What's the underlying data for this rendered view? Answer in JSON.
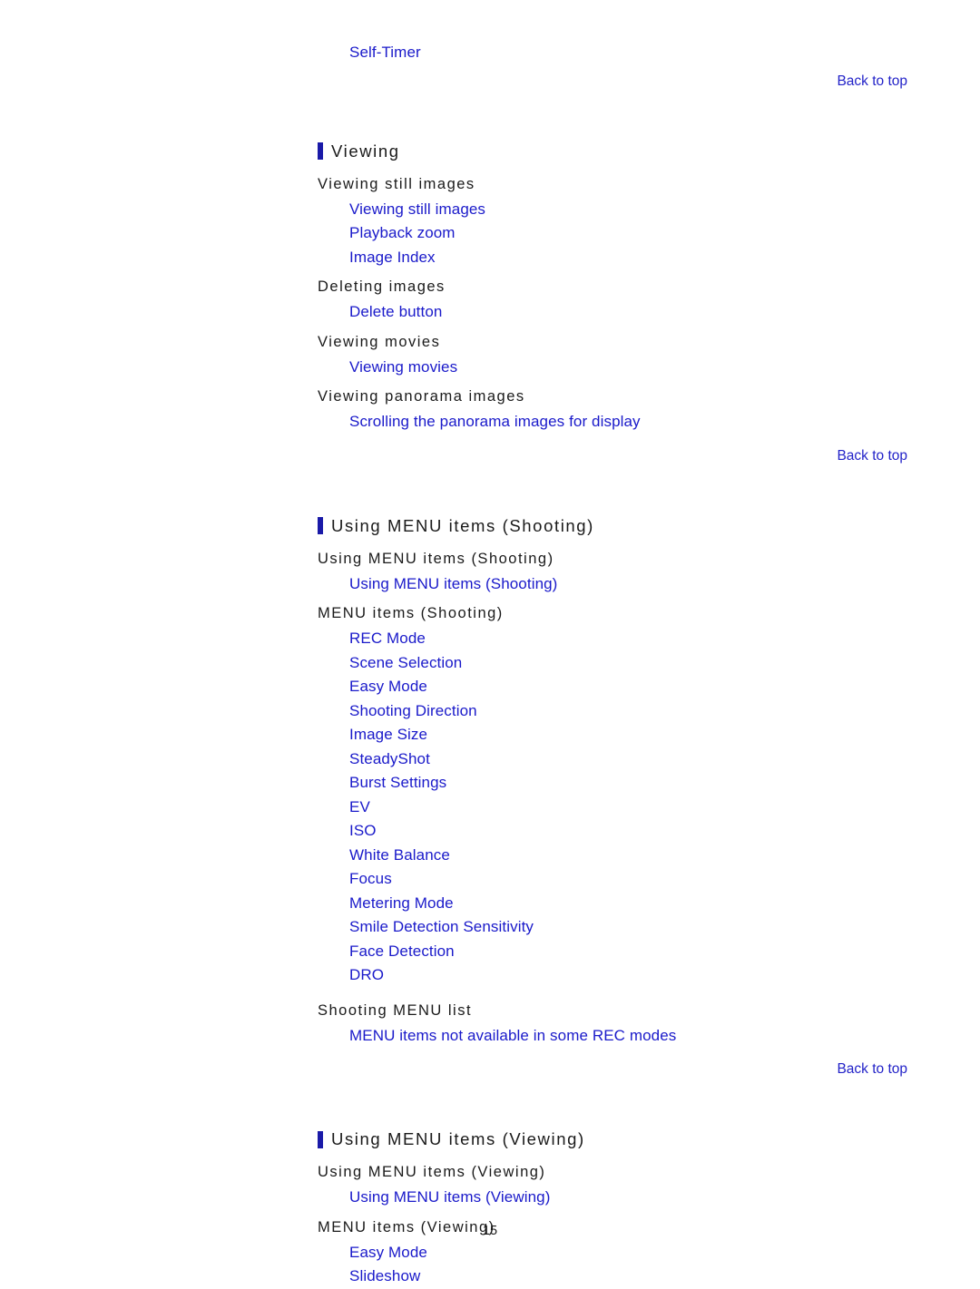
{
  "page": {
    "number": "15",
    "back_to_top_label": "Back to top"
  },
  "top_orphan_link": "Self-Timer",
  "sections": [
    {
      "title": "Viewing",
      "groups": [
        {
          "heading": "Viewing still images",
          "links": [
            "Viewing still images",
            "Playback zoom",
            "Image Index"
          ]
        },
        {
          "heading": "Deleting images",
          "links": [
            "Delete button"
          ]
        },
        {
          "heading": "Viewing movies",
          "links": [
            "Viewing movies"
          ]
        },
        {
          "heading": "Viewing panorama images",
          "links": [
            "Scrolling the panorama images for display"
          ]
        }
      ]
    },
    {
      "title": "Using MENU items (Shooting)",
      "groups": [
        {
          "heading": "Using MENU items (Shooting)",
          "links": [
            "Using MENU items (Shooting)"
          ]
        },
        {
          "heading": "MENU items (Shooting)",
          "links": [
            "REC Mode",
            "Scene Selection",
            "Easy Mode",
            "Shooting Direction",
            "Image Size",
            "SteadyShot",
            "Burst Settings",
            "EV",
            "ISO",
            "White Balance",
            "Focus",
            "Metering Mode",
            "Smile Detection Sensitivity",
            "Face Detection",
            "DRO"
          ]
        },
        {
          "heading": "Shooting MENU list",
          "links": [
            "MENU items not available in some REC modes"
          ]
        }
      ]
    },
    {
      "title": "Using MENU items (Viewing)",
      "groups": [
        {
          "heading": "Using MENU items (Viewing)",
          "links": [
            "Using MENU items (Viewing)"
          ]
        },
        {
          "heading": "MENU items (Viewing)",
          "links": [
            "Easy Mode",
            "Slideshow"
          ]
        }
      ]
    }
  ],
  "colors": {
    "link": "#1a1aca",
    "back_to_top": "#2222c8",
    "section_bar": "#1a1aa8",
    "text": "#1a1a1a",
    "background": "#ffffff"
  }
}
